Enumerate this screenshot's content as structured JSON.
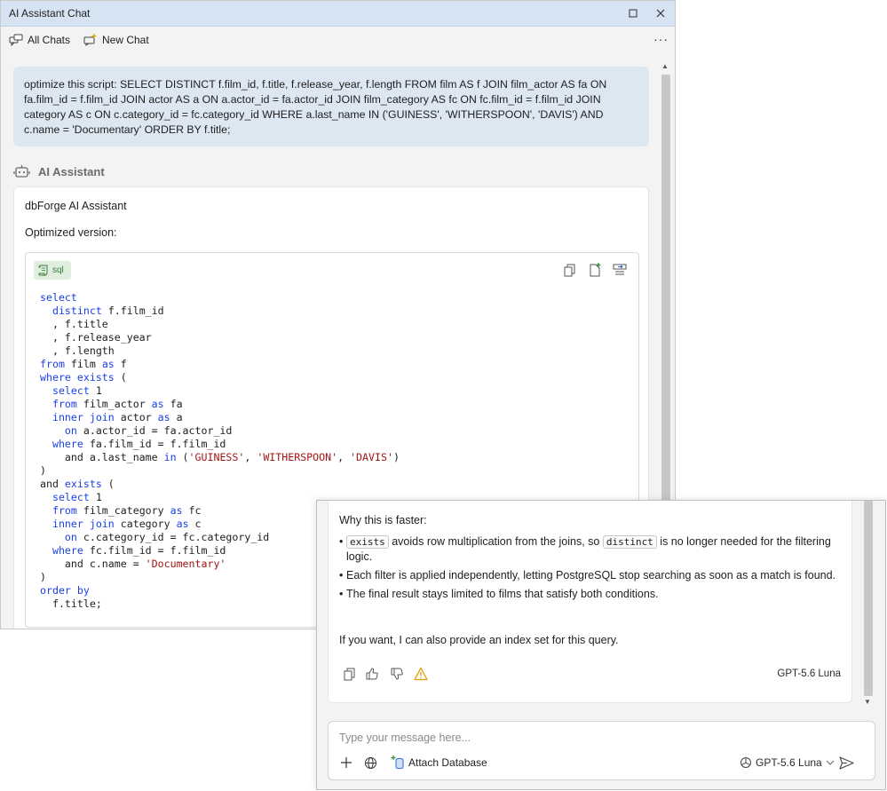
{
  "window": {
    "title": "AI Assistant Chat"
  },
  "toolbar": {
    "all_chats": "All Chats",
    "new_chat": "New Chat",
    "more": "···"
  },
  "user_message": "optimize this script: SELECT DISTINCT f.film_id, f.title, f.release_year, f.length FROM film AS f JOIN film_actor AS fa ON fa.film_id = f.film_id JOIN actor AS a ON a.actor_id = fa.actor_id JOIN film_category AS fc ON fc.film_id = f.film_id JOIN category AS c ON c.category_id = fc.category_id WHERE a.last_name IN ('GUINESS', 'WITHERSPOON', 'DAVIS') AND c.name = 'Documentary' ORDER BY f.title;",
  "assistant": {
    "header_label": "AI Assistant",
    "author": "dbForge AI Assistant",
    "intro": "Optimized version:",
    "code_lang": "sql",
    "code_lines": [
      [
        {
          "t": "select",
          "c": "kw"
        }
      ],
      [
        {
          "t": "  "
        },
        {
          "t": "distinct",
          "c": "kw"
        },
        {
          "t": " f.film_id"
        }
      ],
      [
        {
          "t": "  , f.title"
        }
      ],
      [
        {
          "t": "  , f.release_year"
        }
      ],
      [
        {
          "t": "  , f.length"
        }
      ],
      [
        {
          "t": "from",
          "c": "kw"
        },
        {
          "t": " film "
        },
        {
          "t": "as",
          "c": "kw"
        },
        {
          "t": " f"
        }
      ],
      [
        {
          "t": "where",
          "c": "kw"
        },
        {
          "t": " "
        },
        {
          "t": "exists",
          "c": "kw"
        },
        {
          "t": " ("
        }
      ],
      [
        {
          "t": "  "
        },
        {
          "t": "select",
          "c": "kw"
        },
        {
          "t": " 1"
        }
      ],
      [
        {
          "t": "  "
        },
        {
          "t": "from",
          "c": "kw"
        },
        {
          "t": " film_actor "
        },
        {
          "t": "as",
          "c": "kw"
        },
        {
          "t": " fa"
        }
      ],
      [
        {
          "t": "  "
        },
        {
          "t": "inner join",
          "c": "kw"
        },
        {
          "t": " actor "
        },
        {
          "t": "as",
          "c": "kw"
        },
        {
          "t": " a"
        }
      ],
      [
        {
          "t": "    "
        },
        {
          "t": "on",
          "c": "kw"
        },
        {
          "t": " a.actor_id = fa.actor_id"
        }
      ],
      [
        {
          "t": "  "
        },
        {
          "t": "where",
          "c": "kw"
        },
        {
          "t": " fa.film_id = f.film_id"
        }
      ],
      [
        {
          "t": "    and a.last_name "
        },
        {
          "t": "in",
          "c": "kw"
        },
        {
          "t": " ("
        },
        {
          "t": "'GUINESS'",
          "c": "str"
        },
        {
          "t": ", "
        },
        {
          "t": "'WITHERSPOON'",
          "c": "str"
        },
        {
          "t": ", "
        },
        {
          "t": "'DAVIS'",
          "c": "str"
        },
        {
          "t": ")"
        }
      ],
      [
        {
          "t": ")"
        }
      ],
      [
        {
          "t": "and "
        },
        {
          "t": "exists",
          "c": "kw"
        },
        {
          "t": " ("
        }
      ],
      [
        {
          "t": "  "
        },
        {
          "t": "select",
          "c": "kw"
        },
        {
          "t": " 1"
        }
      ],
      [
        {
          "t": "  "
        },
        {
          "t": "from",
          "c": "kw"
        },
        {
          "t": " film_category "
        },
        {
          "t": "as",
          "c": "kw"
        },
        {
          "t": " fc"
        }
      ],
      [
        {
          "t": "  "
        },
        {
          "t": "inner join",
          "c": "kw"
        },
        {
          "t": " category "
        },
        {
          "t": "as",
          "c": "kw"
        },
        {
          "t": " c"
        }
      ],
      [
        {
          "t": "    "
        },
        {
          "t": "on",
          "c": "kw"
        },
        {
          "t": " c.category_id = fc.category_id"
        }
      ],
      [
        {
          "t": "  "
        },
        {
          "t": "where",
          "c": "kw"
        },
        {
          "t": " fc.film_id = f.film_id"
        }
      ],
      [
        {
          "t": "    and c.name = "
        },
        {
          "t": "'Documentary'",
          "c": "str"
        }
      ],
      [
        {
          "t": ")"
        }
      ],
      [
        {
          "t": "order by",
          "c": "kw"
        }
      ],
      [
        {
          "t": "  f.title;"
        }
      ]
    ]
  },
  "response_tail": {
    "heading": "Why this is faster:",
    "bullets": [
      [
        {
          "t": "exists",
          "chip": true
        },
        {
          "t": " avoids row multiplication from the joins, so "
        },
        {
          "t": "distinct",
          "chip": true
        },
        {
          "t": " is no longer needed for the filtering logic."
        }
      ],
      [
        {
          "t": "Each filter is applied independently, letting PostgreSQL stop searching as soon as a match is found."
        }
      ],
      [
        {
          "t": "The final result stays limited to films that satisfy both conditions."
        }
      ]
    ],
    "followup": "If you want, I can also provide an index set for this query.",
    "model": "GPT-5.6 Luna"
  },
  "composer": {
    "placeholder": "Type your message here...",
    "attach_label": "Attach Database",
    "model": "GPT-5.6 Luna"
  },
  "colors": {
    "keyword": "#1a3ee8",
    "string": "#a31515",
    "accent": "#4a86c8",
    "warning": "#e0a000"
  }
}
